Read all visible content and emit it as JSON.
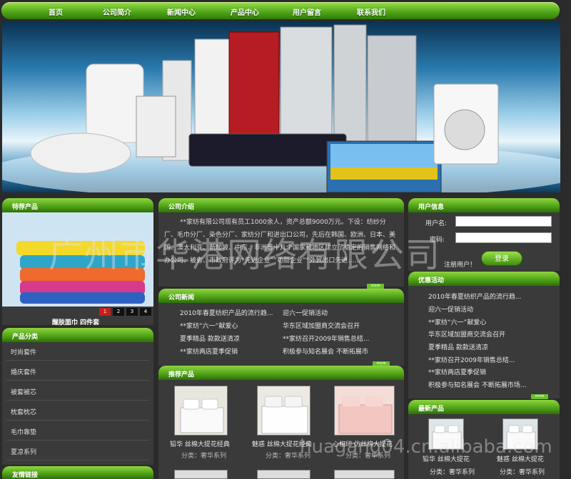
{
  "nav": {
    "items": [
      "首页",
      "公司简介",
      "新闻中心",
      "产品中心",
      "用户留言",
      "联系我们"
    ]
  },
  "featured": {
    "title": "特荐产品",
    "caption": "醒肤面巾 四件套",
    "pages": [
      "1",
      "2",
      "3",
      "4"
    ]
  },
  "categories": {
    "title": "产品分类",
    "items": [
      "时尚套件",
      "婚庆套件",
      "被套被芯",
      "枕套枕芯",
      "毛巾靠垫",
      "夏凉系列"
    ]
  },
  "links": {
    "title": "友情链接"
  },
  "about": {
    "title": "公司介绍",
    "text": "**家纺有限公司现有员工1000余人，资产总额9000万元。下设：纺纱分厂、毛巾分厂、染色分厂、家纺分厂和进出口公司，先后在韩国、欧洲、日本、美国、澳大利亚、新加坡、中东、非洲等十几个国家和地区建立了稳定的销售网络和办公司。被省、市政府评为“先进企业”“功勋企业”“外贸出口先进……",
    "more": "more"
  },
  "news": {
    "title": "公司新闻",
    "left": [
      "2010年春夏纺织产品的流行趋...",
      "**家纺“六一”献爱心",
      "夏季精品  款款送清凉",
      "**家纺两店夏季促销"
    ],
    "right": [
      "迎六一促销活动",
      "华东区域加盟商交流会召开",
      "**家纺召开2009年销售总结...",
      "积极参与知名展会  不断拓展市"
    ],
    "more": "more"
  },
  "recommended": {
    "title": "推荐产品",
    "items": [
      {
        "name": "铅华  丝棉大提花经典",
        "category": "分类：奢华系列"
      },
      {
        "name": "魅惑  丝棉大提花经典",
        "category": "分类：奢华系列"
      },
      {
        "name": "心相印  仿丝棉大提花",
        "category": "分类：奢华系列"
      }
    ]
  },
  "user": {
    "title": "用户信息",
    "username_label": "用户名:",
    "password_label": "密码:",
    "register": "注册用户！",
    "login": "登录"
  },
  "promo": {
    "title": "优惠活动",
    "items": [
      "2010年春夏纺织产品的流行趋...",
      "迎六一促销活动",
      "**家纺“六一”献爱心",
      "华东区域加盟商交流会召开",
      "夏季精品  款款送清凉",
      "**家纺召开2009年销售总结...",
      "**家纺两店夏季促销",
      "积极参与知名展会  不断拓展市场..."
    ],
    "more": "more"
  },
  "latest": {
    "title": "最新产品",
    "items": [
      {
        "name": "铅华  丝棉大提花",
        "category": "分类：奢华系列"
      },
      {
        "name": "魅惑  丝棉大提花",
        "category": "分类：奢华系列"
      }
    ]
  },
  "watermark": {
    "top": "广州市华港网络有限公司",
    "bottom": "huagang04.cn.alibaba.com"
  },
  "colors": {
    "accent": "#5aae1e",
    "background": "#2b2b2b"
  }
}
